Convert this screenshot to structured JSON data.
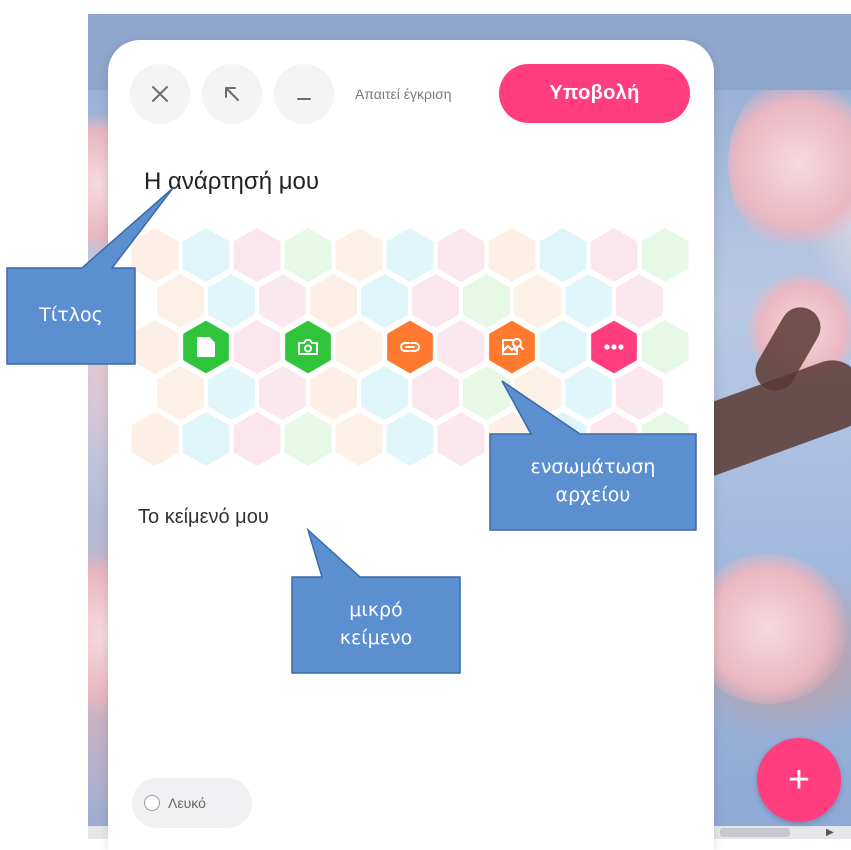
{
  "toolbar": {
    "close_icon": "close-icon",
    "expand_icon": "arrow-up-left-icon",
    "minimize_icon": "minimize-icon",
    "approval_text": "Απαιτεί έγκριση",
    "submit_label": "Υποβολή"
  },
  "post": {
    "title": "Η ανάρτησή μου",
    "body": "Το κείμενό μου"
  },
  "attachments": [
    {
      "name": "upload-file-icon",
      "color": "#2fc43a"
    },
    {
      "name": "camera-icon",
      "color": "#2fc43a"
    },
    {
      "name": "link-icon",
      "color": "#ff7a2e"
    },
    {
      "name": "image-search-icon",
      "color": "#ff7a2e"
    },
    {
      "name": "more-icon",
      "color": "#ff3d7f"
    }
  ],
  "theme": {
    "label": "Λευκό"
  },
  "fab": {
    "label": "+"
  },
  "callouts": {
    "title": "Τίτλος",
    "embed_line1": "ενσωμάτωση",
    "embed_line2": "αρχείου",
    "text_line1": "μικρό",
    "text_line2": "κείμενο"
  },
  "colors": {
    "accent": "#ff3d7f",
    "callout_fill": "#5b8fd0",
    "callout_stroke": "#3b6aa8"
  }
}
